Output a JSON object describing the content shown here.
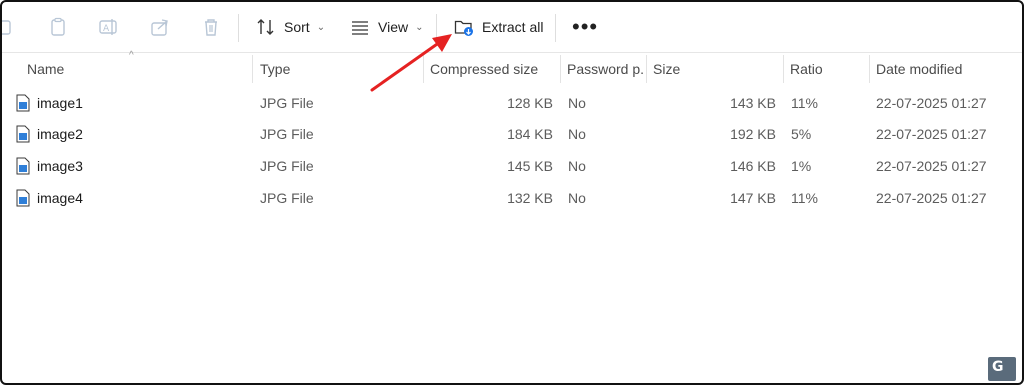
{
  "toolbar": {
    "sort_label": "Sort",
    "view_label": "View",
    "extract_label": "Extract all",
    "more_label": "•••"
  },
  "columns": {
    "name": "Name",
    "type": "Type",
    "compressed_size": "Compressed size",
    "password": "Password p...",
    "size": "Size",
    "ratio": "Ratio",
    "date_modified": "Date modified"
  },
  "files": [
    {
      "name": "image1",
      "type": "JPG File",
      "compressed": "128 KB",
      "password": "No",
      "size": "143 KB",
      "ratio": "11%",
      "date": "22-07-2025 01:27"
    },
    {
      "name": "image2",
      "type": "JPG File",
      "compressed": "184 KB",
      "password": "No",
      "size": "192 KB",
      "ratio": "5%",
      "date": "22-07-2025 01:27"
    },
    {
      "name": "image3",
      "type": "JPG File",
      "compressed": "145 KB",
      "password": "No",
      "size": "146 KB",
      "ratio": "1%",
      "date": "22-07-2025 01:27"
    },
    {
      "name": "image4",
      "type": "JPG File",
      "compressed": "132 KB",
      "password": "No",
      "size": "147 KB",
      "ratio": "11%",
      "date": "22-07-2025 01:27"
    }
  ],
  "colors": {
    "accent": "#1b74e8",
    "annotation_arrow": "#e52222"
  },
  "watermark": "G"
}
